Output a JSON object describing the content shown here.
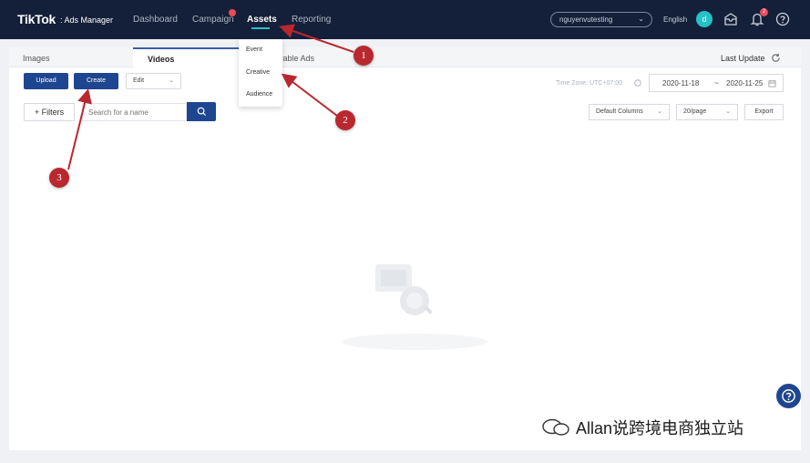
{
  "brand": {
    "logo": "TikTok",
    "sub": ": Ads Manager"
  },
  "nav": {
    "items": [
      {
        "label": "Dashboard"
      },
      {
        "label": "Campaign"
      },
      {
        "label": "Assets"
      },
      {
        "label": "Reporting"
      }
    ],
    "active": "Assets",
    "campaign_badge_color": "#e84b5a"
  },
  "account": {
    "name": "nguyenvutesting"
  },
  "language": "English",
  "avatar_initial": "d",
  "notifications": {
    "count": "2"
  },
  "tabs": [
    {
      "label": "Images"
    },
    {
      "label": "Videos"
    },
    {
      "label": "yable Ads"
    }
  ],
  "active_tab": "Videos",
  "last_update": "Last Update",
  "toolbar": {
    "upload": "Upload",
    "create": "Create",
    "edit": "Edit"
  },
  "timezone": "Time Zone: UTC+07:00",
  "date_range": {
    "start": "2020-11-18",
    "sep": "~",
    "end": "2020-11-25"
  },
  "filters": {
    "label": "+ Filters",
    "search_placeholder": "Search for a name",
    "columns": "Default Columns",
    "page_size": "20/page",
    "export": "Export"
  },
  "assets_menu": [
    {
      "label": "Event"
    },
    {
      "label": "Creative"
    },
    {
      "label": "Audience"
    }
  ],
  "annotations": [
    {
      "label": "1"
    },
    {
      "label": "2"
    },
    {
      "label": "3"
    }
  ],
  "watermark": "Allan说跨境电商独立站",
  "colors": {
    "nav_bg": "#14203a",
    "primary": "#1e4690",
    "accent": "#25c2c7",
    "annotation": "#b8282e"
  },
  "icons": [
    "refresh-icon",
    "calendar-icon",
    "search-icon",
    "inbox-icon",
    "bell-icon",
    "help-circle-icon",
    "chevron-down-icon",
    "wechat-icon"
  ]
}
